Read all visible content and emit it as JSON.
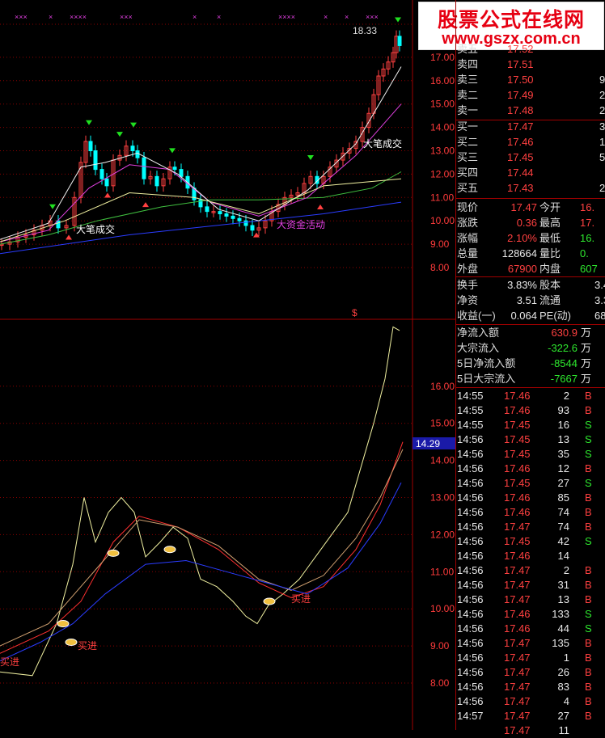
{
  "watermark": {
    "title": "股票公式在线网",
    "url": "www.gszx.com.cn"
  },
  "top_chart": {
    "y_ticks": [
      "17.00",
      "16.00",
      "15.00",
      "14.00",
      "13.00",
      "12.00",
      "11.00",
      "10.00",
      "9.00",
      "8.00"
    ],
    "y_min": 8.0,
    "y_max": 18.5,
    "high_label": "18.33",
    "annotations": {
      "big_deal_1": "大笔成交",
      "big_deal_2": "大笔成交",
      "big_money": "大资金活动"
    },
    "marker": "$"
  },
  "bottom_chart": {
    "y_ticks": [
      "16.00",
      "15.00",
      "14.00",
      "13.00",
      "12.00",
      "11.00",
      "10.00",
      "9.00",
      "8.00"
    ],
    "y_min": 7.6,
    "y_max": 17.7,
    "current_tag": "14.29",
    "buy_label": "买进"
  },
  "order_book": [
    {
      "label": "卖五",
      "price": "17.52",
      "vol": ""
    },
    {
      "label": "卖四",
      "price": "17.51",
      "vol": ""
    },
    {
      "label": "卖三",
      "price": "17.50",
      "vol": "9"
    },
    {
      "label": "卖二",
      "price": "17.49",
      "vol": "2"
    },
    {
      "label": "卖一",
      "price": "17.48",
      "vol": "2"
    },
    {
      "label": "买一",
      "price": "17.47",
      "vol": "3"
    },
    {
      "label": "买二",
      "price": "17.46",
      "vol": "1"
    },
    {
      "label": "买三",
      "price": "17.45",
      "vol": "5"
    },
    {
      "label": "买四",
      "price": "17.44",
      "vol": ""
    },
    {
      "label": "买五",
      "price": "17.43",
      "vol": "2"
    }
  ],
  "quote": [
    {
      "l1": "现价",
      "v1": "17.47",
      "c1": "red",
      "l2": "今开",
      "v2": "16.",
      "c2": "red"
    },
    {
      "l1": "涨跌",
      "v1": "0.36",
      "c1": "red",
      "l2": "最高",
      "v2": "17.",
      "c2": "red"
    },
    {
      "l1": "涨幅",
      "v1": "2.10%",
      "c1": "red",
      "l2": "最低",
      "v2": "16.",
      "c2": "green"
    },
    {
      "l1": "总量",
      "v1": "128664",
      "c1": "wht",
      "l2": "量比",
      "v2": "0.",
      "c2": "green"
    },
    {
      "l1": "外盘",
      "v1": "67900",
      "c1": "red",
      "l2": "内盘",
      "v2": "607",
      "c2": "green"
    }
  ],
  "fundamentals": [
    {
      "l1": "换手",
      "v1": "3.83%",
      "l2": "股本",
      "v2": "3.40"
    },
    {
      "l1": "净资",
      "v1": "3.51",
      "l2": "流通",
      "v2": "3.36"
    },
    {
      "l1": "收益(一)",
      "v1": "0.064",
      "l2": "PE(动)",
      "v2": "68"
    }
  ],
  "flows": [
    {
      "label": "净流入额",
      "value": "630.9",
      "unit": "万",
      "color": "red"
    },
    {
      "label": "大宗流入",
      "value": "-322.6",
      "unit": "万",
      "color": "green"
    },
    {
      "label": "5日净流入额",
      "value": "-8544",
      "unit": "万",
      "color": "green"
    },
    {
      "label": "5日大宗流入",
      "value": "-7667",
      "unit": "万",
      "color": "green"
    }
  ],
  "trades": [
    {
      "t": "14:55",
      "p": "17.46",
      "v": "2",
      "s": "B"
    },
    {
      "t": "14:55",
      "p": "17.46",
      "v": "93",
      "s": "B"
    },
    {
      "t": "14:55",
      "p": "17.45",
      "v": "16",
      "s": "S"
    },
    {
      "t": "14:56",
      "p": "17.45",
      "v": "13",
      "s": "S"
    },
    {
      "t": "14:56",
      "p": "17.45",
      "v": "35",
      "s": "S"
    },
    {
      "t": "14:56",
      "p": "17.46",
      "v": "12",
      "s": "B"
    },
    {
      "t": "14:56",
      "p": "17.45",
      "v": "27",
      "s": "S"
    },
    {
      "t": "14:56",
      "p": "17.46",
      "v": "85",
      "s": "B"
    },
    {
      "t": "14:56",
      "p": "17.46",
      "v": "74",
      "s": "B"
    },
    {
      "t": "14:56",
      "p": "17.47",
      "v": "74",
      "s": "B"
    },
    {
      "t": "14:56",
      "p": "17.45",
      "v": "42",
      "s": "S"
    },
    {
      "t": "14:56",
      "p": "17.46",
      "v": "14",
      "s": ""
    },
    {
      "t": "14:56",
      "p": "17.47",
      "v": "2",
      "s": "B"
    },
    {
      "t": "14:56",
      "p": "17.47",
      "v": "31",
      "s": "B"
    },
    {
      "t": "14:56",
      "p": "17.47",
      "v": "13",
      "s": "B"
    },
    {
      "t": "14:56",
      "p": "17.46",
      "v": "133",
      "s": "S"
    },
    {
      "t": "14:56",
      "p": "17.46",
      "v": "44",
      "s": "S"
    },
    {
      "t": "14:56",
      "p": "17.47",
      "v": "135",
      "s": "B"
    },
    {
      "t": "14:56",
      "p": "17.47",
      "v": "1",
      "s": "B"
    },
    {
      "t": "14:56",
      "p": "17.47",
      "v": "26",
      "s": "B"
    },
    {
      "t": "14:56",
      "p": "17.47",
      "v": "83",
      "s": "B"
    },
    {
      "t": "14:56",
      "p": "17.47",
      "v": "4",
      "s": "B"
    },
    {
      "t": "14:57",
      "p": "17.47",
      "v": "27",
      "s": "B"
    },
    {
      "t": "",
      "p": "17.47",
      "v": "11",
      "s": ""
    }
  ],
  "colors": {
    "up": "#ff4040",
    "down": "#2ee82e",
    "grid": "#8b0000",
    "frame": "#a00000"
  }
}
